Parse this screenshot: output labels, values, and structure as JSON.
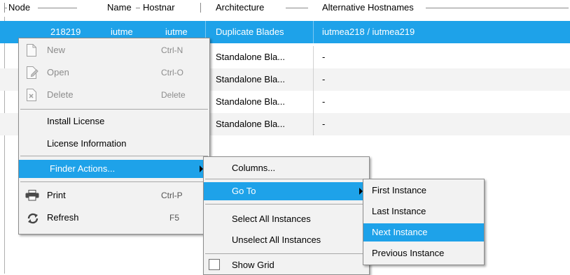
{
  "table": {
    "columns": [
      "Node",
      "Name",
      "Hostnar",
      "Architecture",
      "Alternative Hostnames"
    ],
    "rows": [
      {
        "node": "218219",
        "name": "iutme",
        "host": "iutme",
        "arch": "Duplicate Blades",
        "alt": "iutmea218 / iutmea219"
      },
      {
        "arch": "Standalone Bla...",
        "alt": "-"
      },
      {
        "arch": "Standalone Bla...",
        "alt": "-"
      },
      {
        "arch": "Standalone Bla...",
        "alt": "-"
      },
      {
        "arch": "Standalone Bla...",
        "alt": "-"
      }
    ]
  },
  "context_menu": {
    "new": {
      "label": "New",
      "shortcut": "Ctrl-N"
    },
    "open": {
      "label": "Open",
      "shortcut": "Ctrl-O"
    },
    "delete": {
      "label": "Delete",
      "shortcut": "Delete"
    },
    "install_license": {
      "label": "Install License"
    },
    "license_information": {
      "label": "License Information"
    },
    "finder_actions": {
      "label": "Finder Actions..."
    },
    "print": {
      "label": "Print",
      "shortcut": "Ctrl-P"
    },
    "refresh": {
      "label": "Refresh",
      "shortcut": "F5"
    }
  },
  "finder_menu": {
    "columns": {
      "label": "Columns..."
    },
    "go_to": {
      "label": "Go To"
    },
    "select_all": {
      "label": "Select All Instances"
    },
    "unselect_all": {
      "label": "Unselect All Instances"
    },
    "show_grid": {
      "label": "Show Grid",
      "checked": false
    }
  },
  "goto_menu": {
    "first": {
      "label": "First Instance"
    },
    "last": {
      "label": "Last Instance"
    },
    "next": {
      "label": "Next Instance"
    },
    "previous": {
      "label": "Previous Instance"
    }
  },
  "colors": {
    "selection": "#1ea2e9",
    "menu_bg": "#f2f2f2"
  }
}
